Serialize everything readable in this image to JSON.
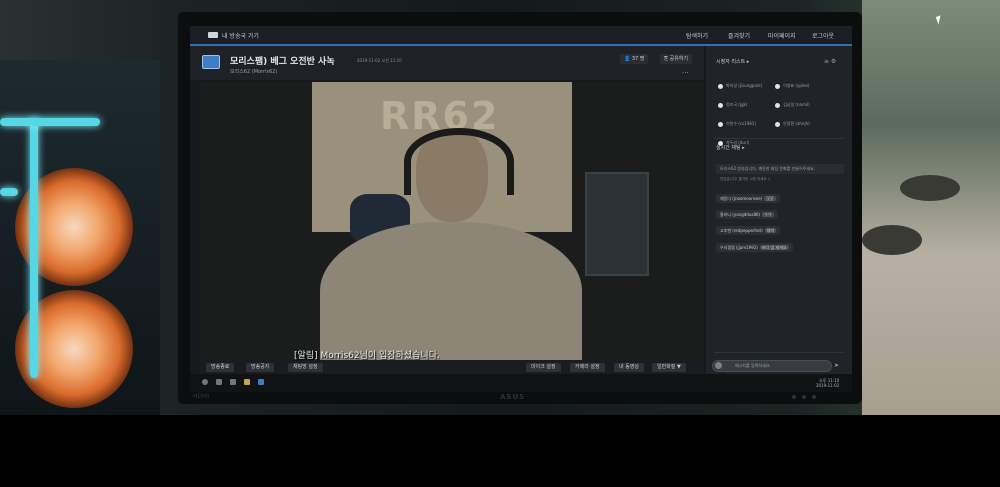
{
  "app": {
    "name": "내 방송국 가기",
    "nav": [
      "탐색하기",
      "즐겨찾기",
      "마이페이지",
      "로그아웃"
    ]
  },
  "stream": {
    "title": "모리스팸) 베그 오전반 사녹",
    "date": "2019-11-02 오전 11:10",
    "streamer": "모리스62 (Morris62)",
    "viewers": "37 명",
    "share_label": "공유하기",
    "more": "..."
  },
  "video": {
    "subtitle": "[알림] Morris62님이 입장하셨습니다.",
    "poster_text": "RR62"
  },
  "controls": {
    "left": [
      "방송종료",
      "방송공지",
      "채팅방 설정"
    ],
    "right": [
      "마이크 설정",
      "카메라 설정",
      "내 동영상",
      "일반화질 ▼"
    ]
  },
  "sidebar": {
    "viewers_title": "시청자 리스트 ▸",
    "viewers": [
      "박지성 (jisungpark)",
      "이영표 (yplee)",
      "정조국 (jgk)",
      "김남일 (namil)",
      "이천수 (cs1981)",
      "안정환 (ahnjh)",
      "차두리 (duri)"
    ],
    "chat_title": "실시간 채팅 ▸",
    "system_msg": "모리스62 방송입니다. 깨끗한 채팅 문화를 만들어주세요.",
    "system_sub": "반갑습니다! 즐거운 시청 되세요 :)",
    "messages": [
      {
        "text": "재밌다 (jnoomoonsee)",
        "tag": "굿굿"
      },
      {
        "text": "홍라니 (yangddus86)",
        "tag": "ㅋㅋ"
      },
      {
        "text": "고추맨 (redpepperhot)",
        "tag": "대박"
      },
      {
        "text": "우리잼잼 (jjam1992)",
        "tag": "바다 엄 세게요"
      }
    ],
    "input_placeholder": "메시지를 입력하세요.",
    "send_icon": "send-icon"
  },
  "taskbar": {
    "time": "오후 11:10",
    "date": "2019-11-02"
  },
  "bezel": {
    "brand": "ASUS",
    "hdmi": "HDMI"
  },
  "colors": {
    "accent": "#2f6fb5",
    "panel": "#202327",
    "fan_glow": "#f2a66b"
  }
}
